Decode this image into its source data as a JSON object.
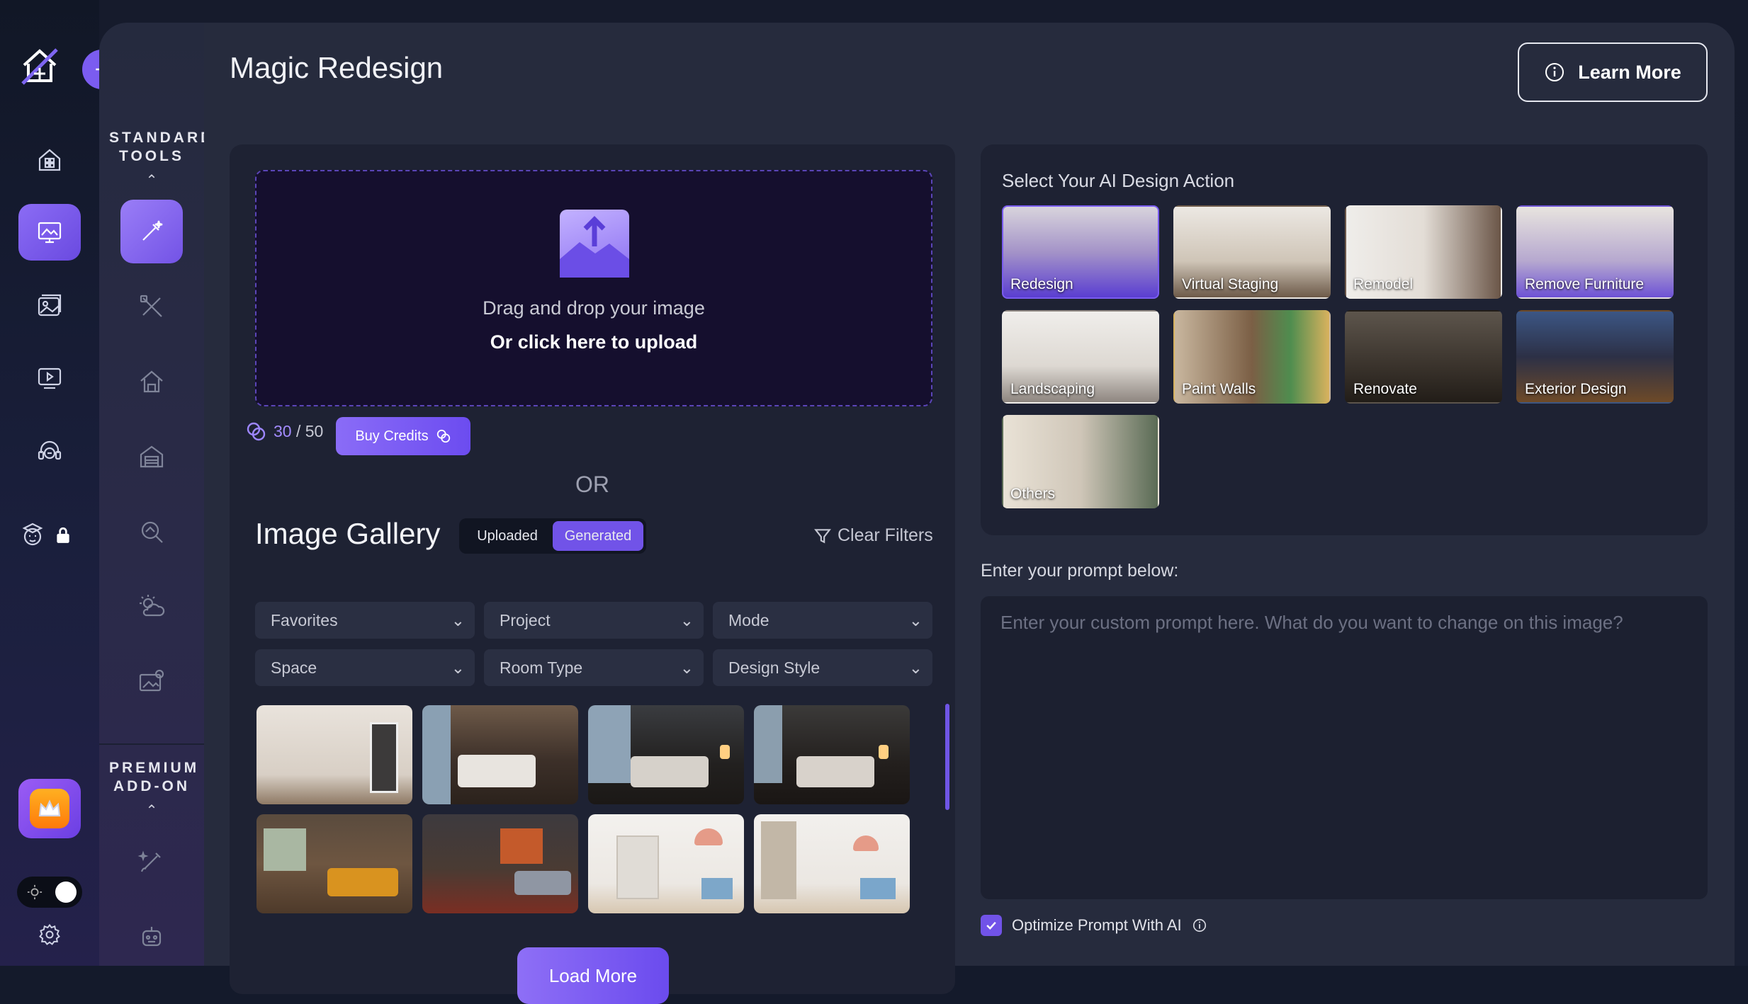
{
  "colors": {
    "accent": "#7153e8",
    "panel": "#1e2233",
    "background": "#262b3d"
  },
  "rail": {
    "items": [
      {
        "name": "dashboard-icon"
      },
      {
        "name": "design-studio-icon",
        "active": true
      },
      {
        "name": "gallery-icon"
      },
      {
        "name": "video-icon"
      },
      {
        "name": "support-icon"
      },
      {
        "name": "academy-icon",
        "locked": true
      }
    ],
    "premium_icon": "crown-icon",
    "settings_icon": "gear-icon"
  },
  "tools": {
    "standard_title": "STANDARD TOOLS",
    "premium_title": "PREMIUM ADD-ON",
    "standard_items": [
      "magic-wand-icon",
      "tools-icon",
      "house-icon",
      "garage-icon",
      "inspect-icon",
      "weather-icon",
      "image-edit-icon"
    ],
    "premium_items": [
      "brush-icon",
      "robot-icon"
    ]
  },
  "header": {
    "title": "Magic Redesign",
    "learn_more": "Learn More"
  },
  "upload": {
    "line1": "Drag and drop your image",
    "line2": "Or click here to upload"
  },
  "credits": {
    "used": "30",
    "separator": " / ",
    "total": "50",
    "buy_label": "Buy Credits"
  },
  "or_label": "OR",
  "gallery": {
    "title": "Image Gallery",
    "tabs": [
      {
        "label": "Uploaded",
        "active": false
      },
      {
        "label": "Generated",
        "active": true
      }
    ],
    "clear_filters": "Clear Filters",
    "filters": [
      "Favorites",
      "Project",
      "Mode",
      "Space",
      "Room Type",
      "Design Style"
    ],
    "load_more": "Load More"
  },
  "actions": {
    "title": "Select Your AI Design Action",
    "items": [
      {
        "label": "Redesign",
        "active": true
      },
      {
        "label": "Virtual Staging"
      },
      {
        "label": "Remodel"
      },
      {
        "label": "Remove Furniture"
      },
      {
        "label": "Landscaping"
      },
      {
        "label": "Paint Walls"
      },
      {
        "label": "Renovate"
      },
      {
        "label": "Exterior Design"
      },
      {
        "label": "Others"
      }
    ]
  },
  "prompt": {
    "label": "Enter your prompt below:",
    "placeholder": "Enter your custom prompt here. What do you want to change on this image?",
    "optimize_label": "Optimize Prompt With AI",
    "optimize_checked": true
  }
}
